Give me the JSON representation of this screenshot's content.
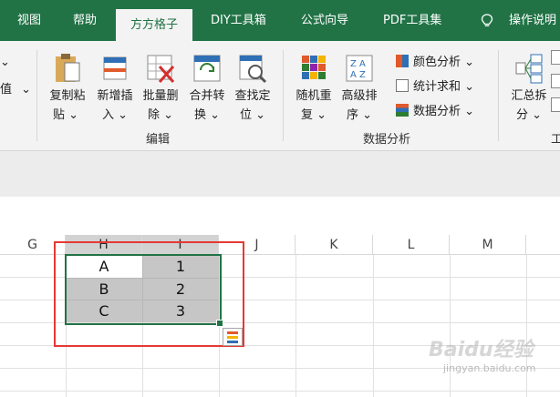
{
  "tabs": [
    {
      "label": "视图",
      "active": false
    },
    {
      "label": "帮助",
      "active": false
    },
    {
      "label": "方方格子",
      "active": true
    },
    {
      "label": "DIY工具箱",
      "active": false
    },
    {
      "label": "公式向导",
      "active": false
    },
    {
      "label": "PDF工具集",
      "active": false
    },
    {
      "label": "操作说明",
      "active": false
    }
  ],
  "ribbon": {
    "left_partial": {
      "line2": "值"
    },
    "edit_group": {
      "title": "编辑",
      "buttons": [
        {
          "line1": "复制粘",
          "line2": "贴"
        },
        {
          "line1": "新增插",
          "line2": "入"
        },
        {
          "line1": "批量删",
          "line2": "除"
        },
        {
          "line1": "合并转",
          "line2": "换"
        },
        {
          "line1": "查找定",
          "line2": "位"
        }
      ]
    },
    "analysis_group": {
      "title": "数据分析",
      "buttons": [
        {
          "line1": "随机重",
          "line2": "复"
        },
        {
          "line1": "高级排",
          "line2": "序"
        }
      ],
      "small_buttons": [
        {
          "label": "颜色分析"
        },
        {
          "label": "统计求和"
        },
        {
          "label": "数据分析"
        }
      ]
    },
    "right_partial": {
      "button": {
        "line1": "汇总拆",
        "line2": "分"
      },
      "group_title": "工"
    }
  },
  "grid": {
    "columns": [
      "G",
      "H",
      "I",
      "J",
      "K",
      "L",
      "M"
    ],
    "selected_columns": [
      "H",
      "I"
    ],
    "rows": [
      [
        "A",
        "1"
      ],
      [
        "B",
        "2"
      ],
      [
        "C",
        "3"
      ]
    ]
  },
  "watermark": {
    "line1": "Baidu经验",
    "line2": "jingyan.baidu.com"
  },
  "colors": {
    "accent": "#217346",
    "highlight_box": "#e53935",
    "selection_fill": "#c6c6c6"
  }
}
